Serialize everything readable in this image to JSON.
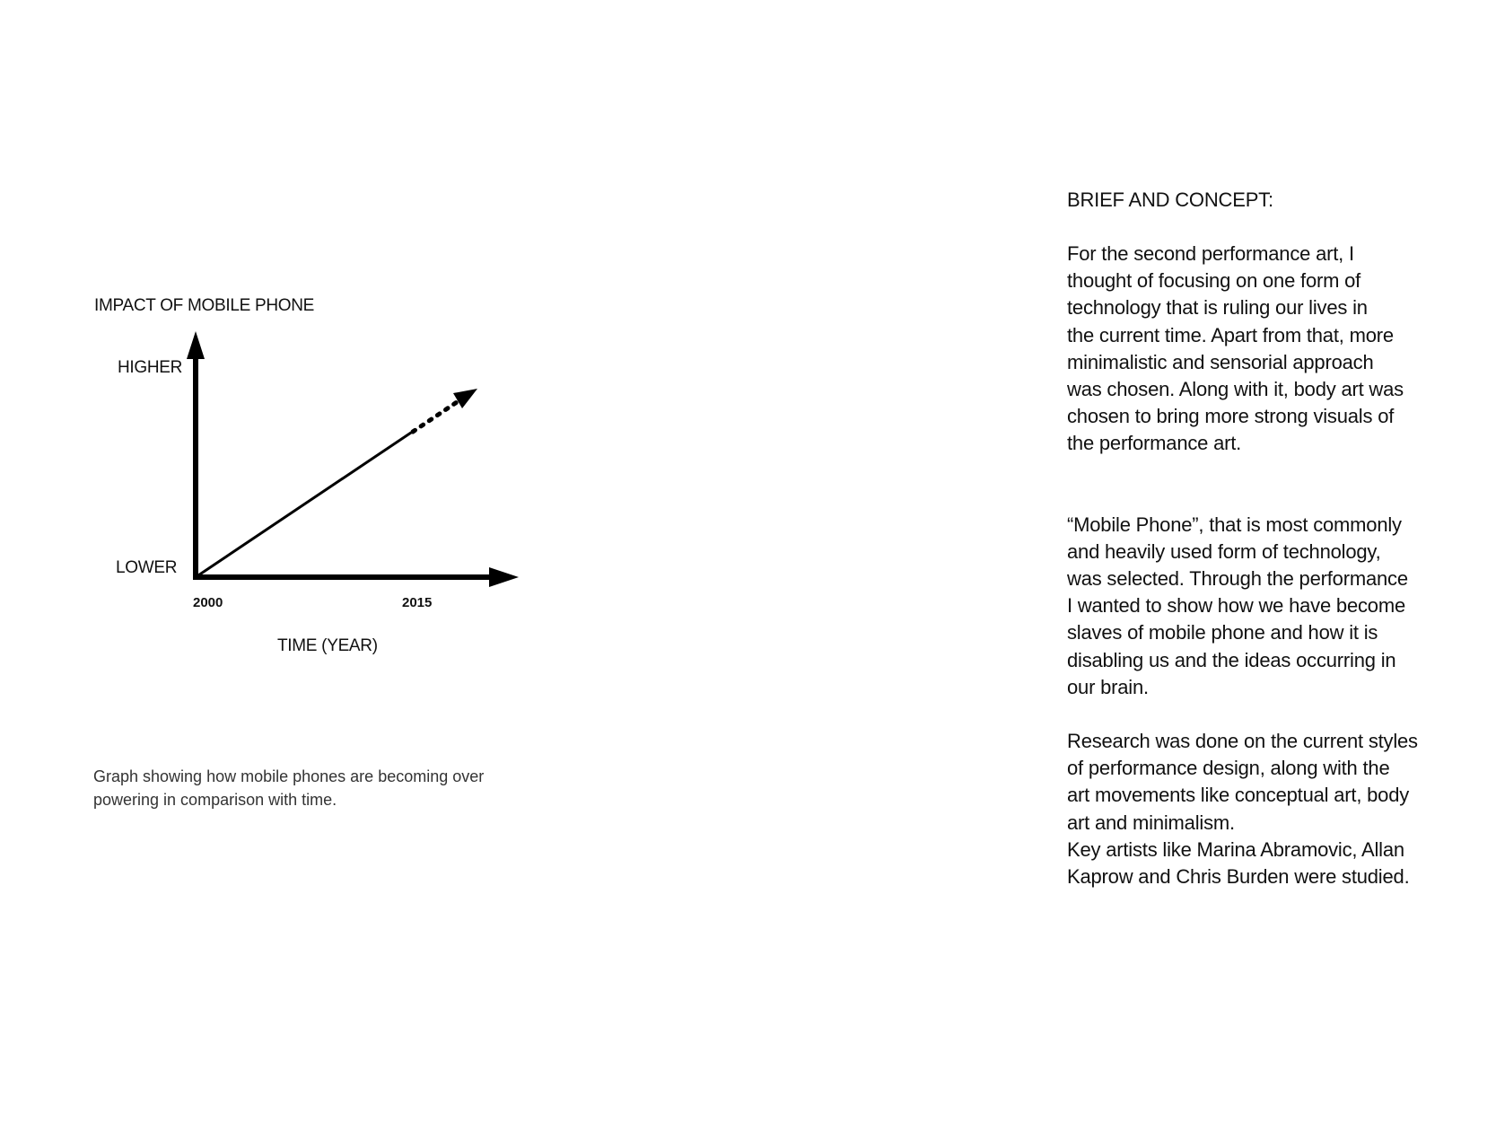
{
  "chart_data": {
    "type": "line",
    "ylabel": "IMPACT OF MOBILE PHONE",
    "xlabel": "TIME (YEAR)",
    "y_tick_labels": [
      "LOWER",
      "HIGHER"
    ],
    "x_tick_labels": [
      "2000",
      "2015"
    ],
    "series": [
      {
        "x": [
          2000,
          2015
        ],
        "y": [
          "LOWER",
          "rising"
        ],
        "style": "solid",
        "continuation": "dotted arrow (projected increase beyond 2015)"
      }
    ]
  },
  "caption": "Graph showing how mobile phones are becoming over powering in comparison with time.",
  "brief": {
    "heading": "BRIEF AND CONCEPT:",
    "paragraphs": [
      "For the second performance art, I\nthought of focusing on one form of\ntechnology that is ruling our lives in\nthe current time. Apart from that, more\nminimalistic and sensorial approach\nwas chosen. Along with it, body art was\nchosen to bring more strong visuals of\nthe performance art.",
      "“Mobile Phone”, that is most commonly\nand heavily used form of technology,\nwas selected. Through the performance\nI wanted to show how we have become\nslaves of mobile phone and how it is\ndisabling us and the ideas occurring in\nour brain.",
      "Research was done on the current styles\nof performance design, along with the\nart movements like conceptual art, body\nart and minimalism.\nKey artists like Marina Abramovic, Allan\nKaprow and Chris Burden were studied."
    ]
  }
}
